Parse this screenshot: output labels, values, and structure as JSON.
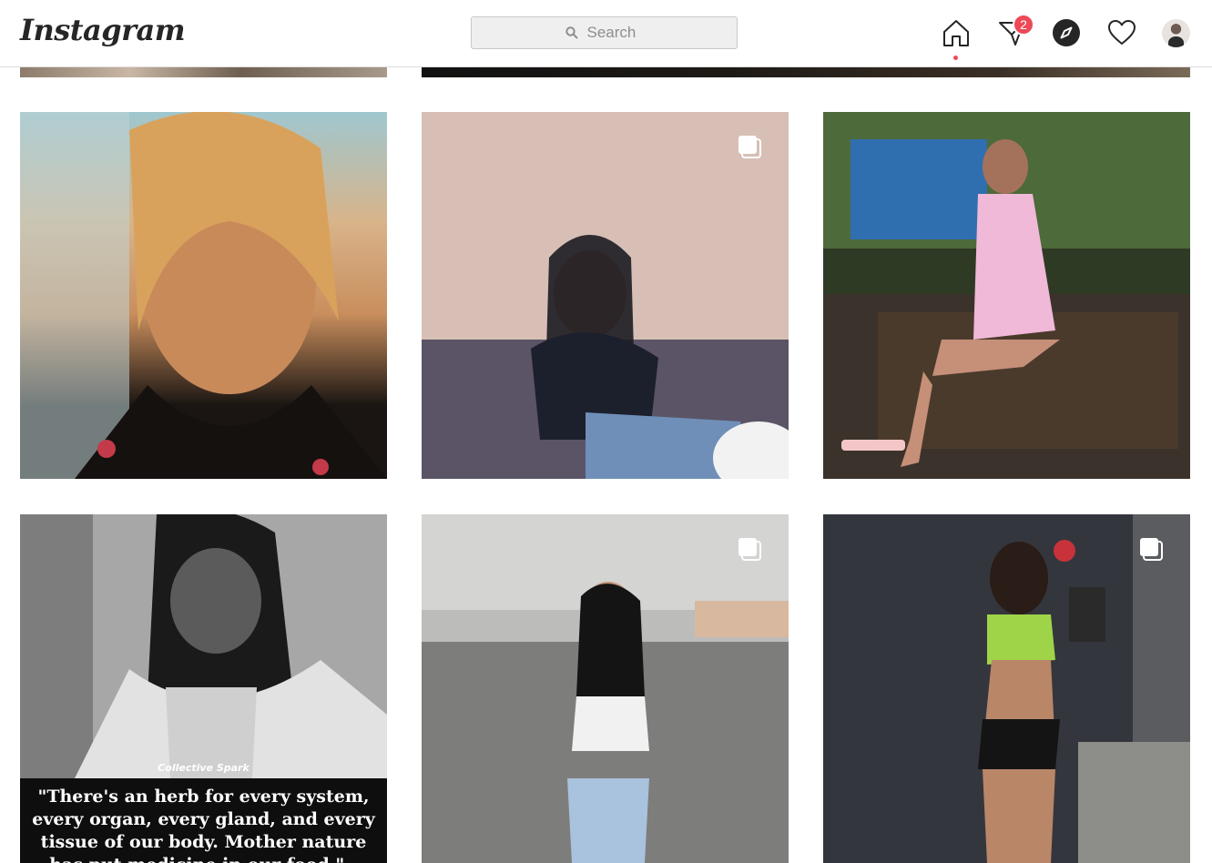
{
  "app": {
    "name": "Instagram"
  },
  "search": {
    "placeholder": "Search"
  },
  "nav": {
    "home": "home-icon",
    "direct": "direct-icon",
    "direct_badge": "2",
    "explore": "compass-icon",
    "activity": "heart-icon",
    "profile": "avatar"
  },
  "colors": {
    "accent_red": "#ed4956",
    "border": "#dbdbdb",
    "search_bg": "#efefef"
  },
  "grid": {
    "posts": [
      {
        "id": "top-left-partial",
        "multi": false
      },
      {
        "id": "top-right-partial",
        "multi": false
      },
      {
        "id": "selfie-blonde",
        "multi": false
      },
      {
        "id": "black-top-sofa",
        "multi": true
      },
      {
        "id": "pink-dress-bench",
        "multi": false
      },
      {
        "id": "bob-marley-quote",
        "multi": false
      },
      {
        "id": "parking-garage",
        "multi": true
      },
      {
        "id": "green-top-brick-wall",
        "multi": true
      }
    ],
    "quote_post": {
      "watermark": "Collective Spark",
      "quote": "\"There's an herb for every system, every organ, every gland, and every tissue of our body. Mother nature has put medicine in our food.\" - Bob Marley"
    }
  }
}
